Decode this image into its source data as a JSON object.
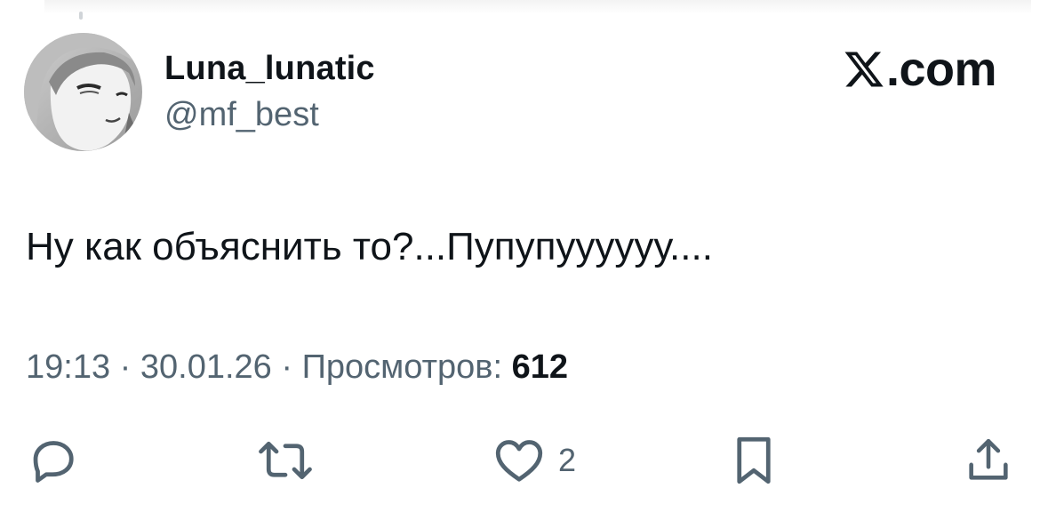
{
  "author": {
    "display_name": "Luna_lunatic",
    "handle": "@mf_best"
  },
  "brand": {
    "icon": "x-logo-icon",
    "text": ".com"
  },
  "tweet": {
    "text": "Ну как объяснить то?...Пупупуууууу...."
  },
  "meta": {
    "time": "19:13",
    "separator": " · ",
    "date": "30.01.26",
    "views_label": "Просмотров:",
    "views_count": "612"
  },
  "actions": {
    "reply_icon": "reply-icon",
    "retweet_icon": "retweet-icon",
    "like_icon": "heart-icon",
    "like_count": "2",
    "bookmark_icon": "bookmark-icon",
    "share_icon": "share-icon"
  },
  "colors": {
    "text_primary": "#0f1419",
    "text_secondary": "#536471",
    "background": "#ffffff"
  }
}
